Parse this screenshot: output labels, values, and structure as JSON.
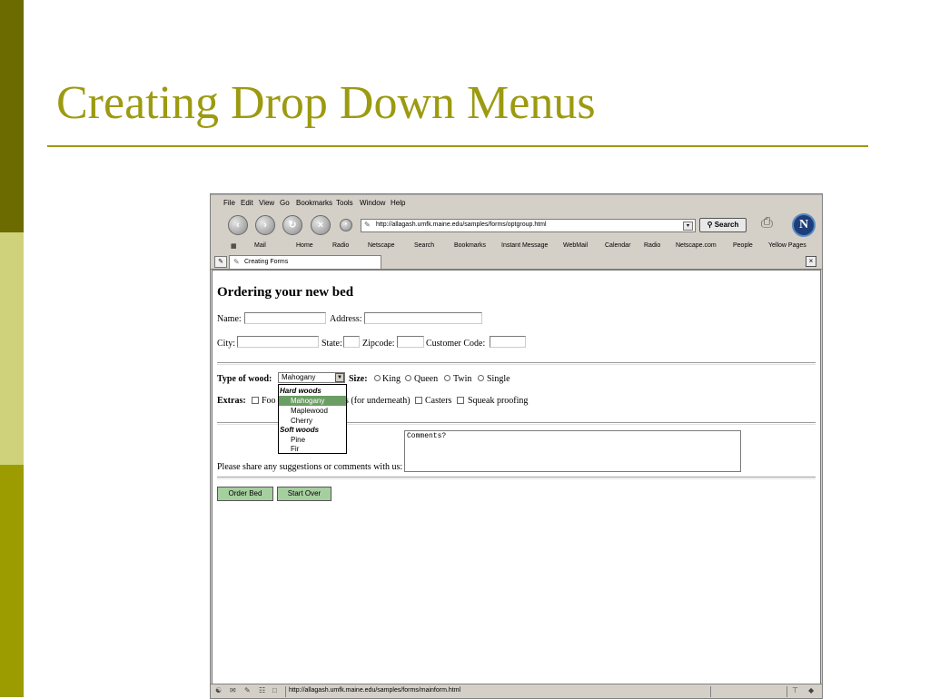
{
  "slide": {
    "title": "Creating Drop Down Menus"
  },
  "browser": {
    "menu": [
      "File",
      "Edit",
      "View",
      "Go",
      "Bookmarks",
      "Tools",
      "Window",
      "Help"
    ],
    "url": "http://allagash.umfk.maine.edu/samples/forms/optgroup.html",
    "search_label": "Search",
    "personal_bar": [
      "Mail",
      "Home",
      "Radio",
      "Netscape",
      "Search",
      "Bookmarks",
      "Instant Message",
      "WebMail",
      "Calendar",
      "Radio",
      "Netscape.com",
      "People",
      "Yellow Pages"
    ],
    "tab_title": "Creating Forms",
    "status_url": "http://allagash.umfk.maine.edu/samples/forms/mainform.html"
  },
  "form": {
    "heading": "Ordering your new bed",
    "name_label": "Name:",
    "address_label": "Address:",
    "city_label": "City:",
    "state_label": "State:",
    "zip_label": "Zipcode:",
    "customer_code_label": "Customer Code:",
    "wood_label": "Type of wood:",
    "wood_selected": "Mahogany",
    "size_label": "Size:",
    "sizes": [
      "King",
      "Queen",
      "Twin",
      "Single"
    ],
    "extras_label": "Extras:",
    "extra_footboard_partial": "Foo",
    "extra_drawers_partial": "s (for underneath)",
    "extra_casters": "Casters",
    "extra_squeak": "Squeak proofing",
    "dropdown": {
      "group_hard": "Hard woods",
      "hard": [
        "Mahogany",
        "Maplewood",
        "Cherry"
      ],
      "group_soft": "Soft woods",
      "soft": [
        "Pine",
        "Fir"
      ]
    },
    "comments_prompt": "Please share any suggestions or comments with us:",
    "comments_value": "Comments?",
    "submit_label": "Order Bed",
    "reset_label": "Start Over"
  },
  "colors": {
    "title": "#9c9a10",
    "band_dark": "#6b6b00",
    "band_light": "#cfd27a",
    "band_mid": "#9c9c00",
    "selected_option": "#6b9e64"
  }
}
